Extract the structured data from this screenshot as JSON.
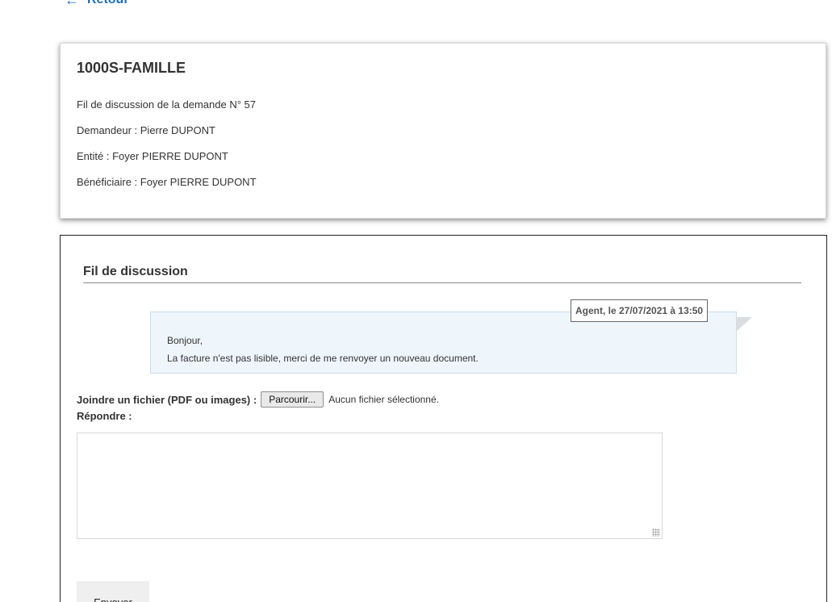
{
  "nav": {
    "back_icon": "arrow-left-icon",
    "back_label": "Retour"
  },
  "request": {
    "title": "1000S-FAMILLE",
    "thread_line": "Fil de discussion de la demande N° 57",
    "requester": "Demandeur : Pierre DUPONT",
    "entity": "Entité : Foyer PIERRE DUPONT",
    "beneficiary": "Bénéficiaire : Foyer PIERRE DUPONT"
  },
  "thread": {
    "title": "Fil de discussion",
    "messages": [
      {
        "meta": "Agent, le 27/07/2021 à 13:50",
        "lines": [
          "Bonjour,",
          "La facture n'est pas lisible, merci de me renvoyer un nouveau document."
        ]
      }
    ]
  },
  "reply_form": {
    "attach_label": "Joindre un fichier (PDF ou images) :",
    "browse_label": "Parcourir...",
    "no_file_text": "Aucun fichier sélectionné.",
    "reply_label": "Répondre :",
    "reply_value": "",
    "send_label": "Envoyer"
  },
  "colors": {
    "link": "#1f6fb5",
    "message_bg": "#eef6fc",
    "message_border": "#c9dcea"
  }
}
